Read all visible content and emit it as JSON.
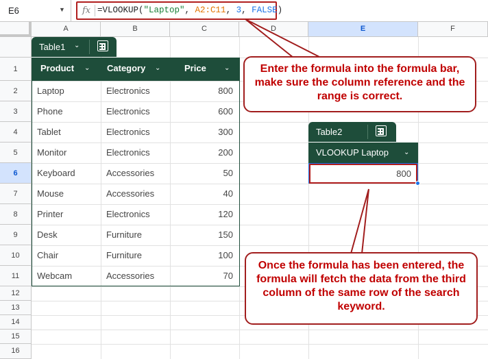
{
  "formula_bar": {
    "cell_ref": "E6",
    "fx_label": "fx",
    "formula": {
      "prefix": "=VLOOKUP(",
      "search_key": "\"Laptop\"",
      "sep1": ", ",
      "range": "A2:C11",
      "sep2": ", ",
      "index": "3",
      "sep3": ", ",
      "is_sorted": "FALSE",
      "suffix": ")"
    }
  },
  "columns": [
    "A",
    "B",
    "C",
    "D",
    "E",
    "F"
  ],
  "selected_column": "E",
  "rows": [
    "1",
    "2",
    "3",
    "4",
    "5",
    "6",
    "7",
    "8",
    "9",
    "10",
    "11",
    "12",
    "13",
    "14",
    "15",
    "16"
  ],
  "selected_row": "6",
  "table1": {
    "name": "Table1",
    "headers": [
      "Product",
      "Category",
      "Price"
    ],
    "data": [
      {
        "product": "Laptop",
        "category": "Electronics",
        "price": "800"
      },
      {
        "product": "Phone",
        "category": "Electronics",
        "price": "600"
      },
      {
        "product": "Tablet",
        "category": "Electronics",
        "price": "300"
      },
      {
        "product": "Monitor",
        "category": "Electronics",
        "price": "200"
      },
      {
        "product": "Keyboard",
        "category": "Accessories",
        "price": "50"
      },
      {
        "product": "Mouse",
        "category": "Accessories",
        "price": "40"
      },
      {
        "product": "Printer",
        "category": "Electronics",
        "price": "120"
      },
      {
        "product": "Desk",
        "category": "Furniture",
        "price": "150"
      },
      {
        "product": "Chair",
        "category": "Furniture",
        "price": "100"
      },
      {
        "product": "Webcam",
        "category": "Accessories",
        "price": "70"
      }
    ]
  },
  "table2": {
    "name": "Table2",
    "header": "VLOOKUP Laptop",
    "value": "800"
  },
  "callouts": {
    "top": "Enter the formula into the formula bar, make sure the column reference and the range is correct.",
    "bottom": "Once the formula has been entered, the formula will fetch the data from the third column of the same row of the search keyword."
  },
  "colors": {
    "table_header": "#1e4d3a",
    "callout_text": "#c00000",
    "callout_border": "#a11d1d",
    "selection": "#1a73e8"
  }
}
